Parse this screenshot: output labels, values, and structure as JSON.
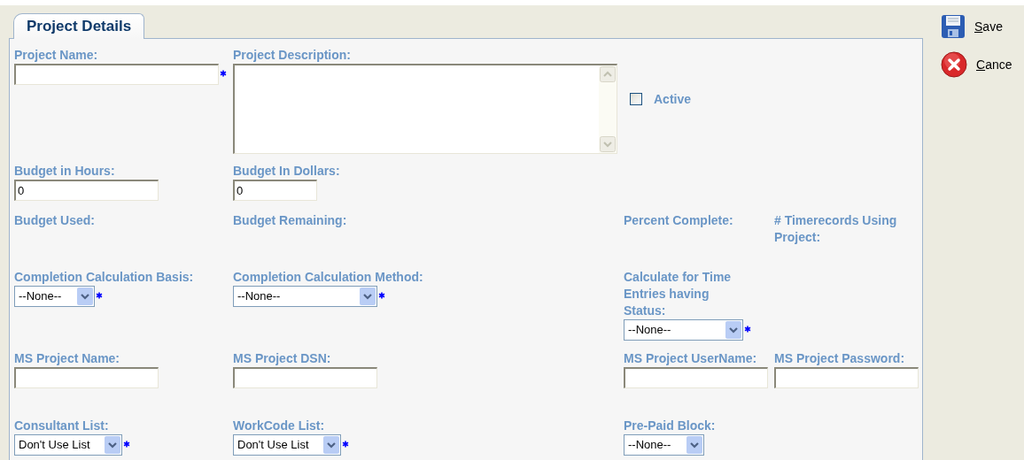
{
  "tabs": [
    {
      "label": "Project Details",
      "selected": true
    }
  ],
  "form_rows": [
    [
      {
        "label": "Project Name:",
        "kind": "text",
        "required": true
      },
      {
        "label": "Project Description:",
        "kind": "textarea",
        "required": false
      },
      {
        "label": "Active",
        "kind": "checkbox",
        "checked": false
      }
    ],
    [
      {
        "label": "Budget in Hours:",
        "kind": "text",
        "value": "0",
        "required": false
      },
      {
        "label": "Budget In Dollars:",
        "kind": "text",
        "value": "0",
        "required": false
      }
    ],
    [
      {
        "label": "Budget Used:",
        "kind": "label"
      },
      {
        "label": "Budget Remaining:",
        "kind": "label"
      },
      {
        "label": "Percent Complete:",
        "kind": "label"
      },
      {
        "label": "# Timerecords Using Project:",
        "kind": "label"
      }
    ],
    [
      {
        "label": "Completion Calculation Basis:",
        "kind": "select",
        "value": "--None--",
        "required": true
      },
      {
        "label": "Completion Calculation Method:",
        "kind": "select",
        "value": "--None--",
        "required": true
      },
      {
        "label": "Calculate for Time Entries having Status:",
        "kind": "select",
        "value": "--None--",
        "required": true
      }
    ],
    [
      {
        "label": "MS Project Name:",
        "kind": "text",
        "required": false
      },
      {
        "label": "MS Project DSN:",
        "kind": "text",
        "required": false
      },
      {
        "label": "MS Project UserName:",
        "kind": "text",
        "required": false
      },
      {
        "label": "MS Project Password:",
        "kind": "text",
        "required": false
      }
    ],
    [
      {
        "label": "Consultant List:",
        "kind": "select",
        "value": "Don't Use List",
        "required": true
      },
      {
        "label": "WorkCode List:",
        "kind": "select",
        "value": "Don't Use List",
        "required": true
      },
      {
        "label": "Pre-Paid Block:",
        "kind": "select",
        "value": "--None--",
        "required": false
      }
    ]
  ],
  "actions": [
    {
      "label": "Save",
      "kind": "save"
    },
    {
      "label": "Cance",
      "kind": "cancel"
    }
  ]
}
